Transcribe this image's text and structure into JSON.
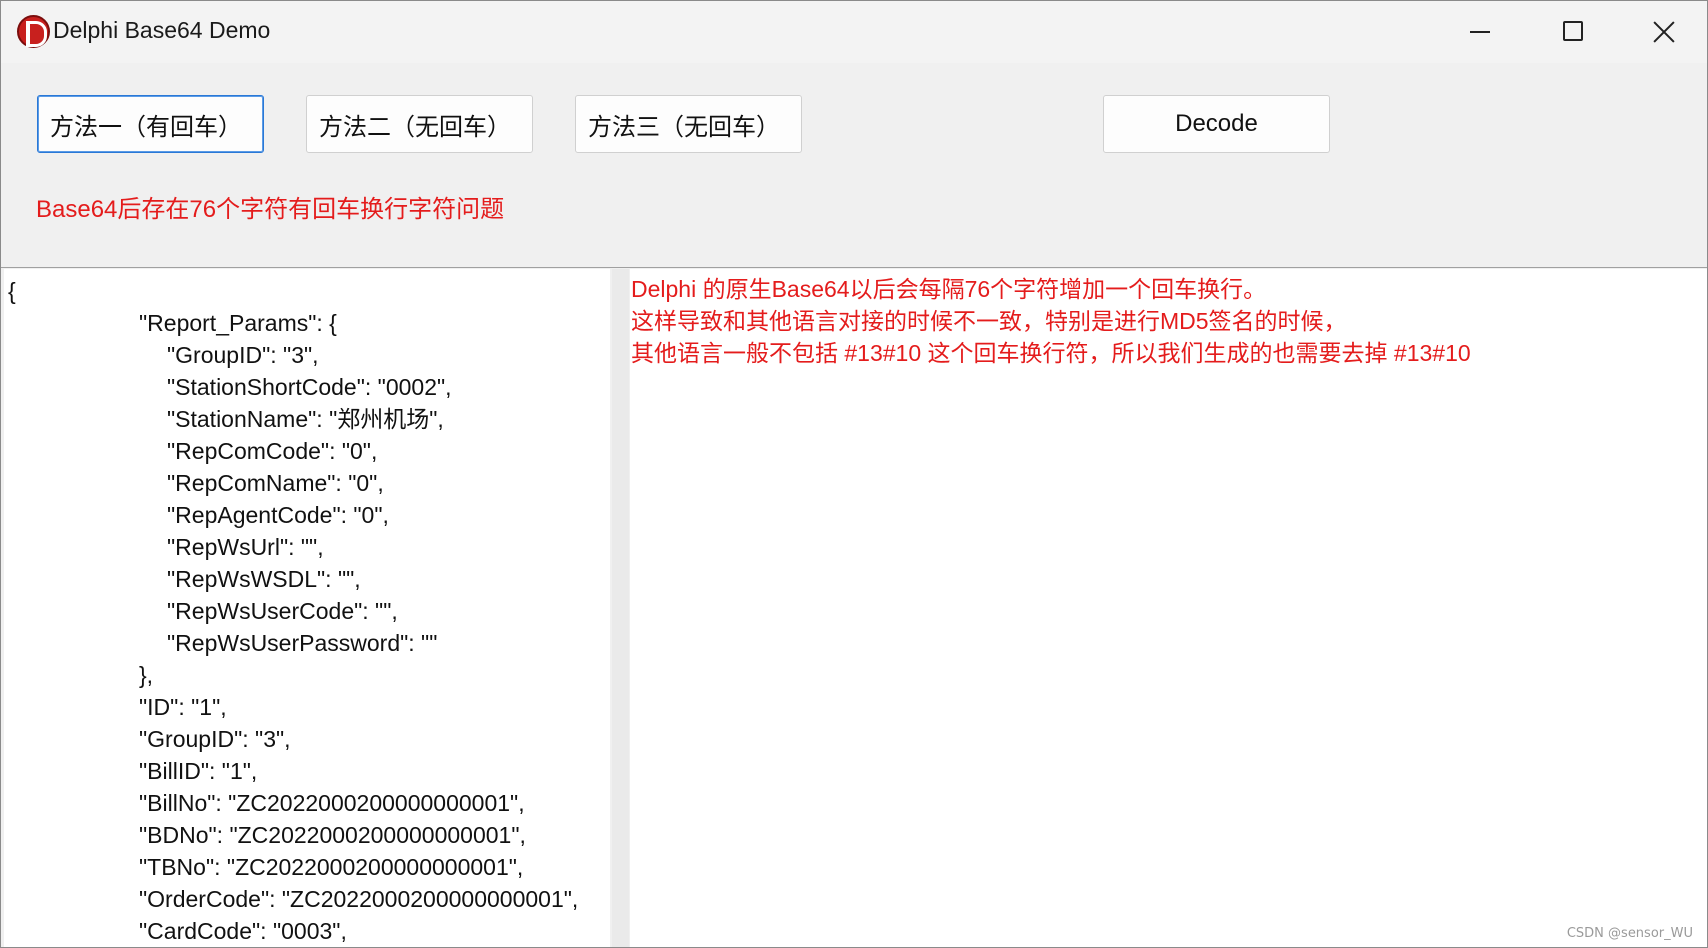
{
  "window": {
    "title": "Delphi Base64 Demo"
  },
  "icons": {
    "app": "delphi-logo-icon",
    "minimize": "minimize-icon",
    "maximize": "maximize-icon",
    "close": "close-icon"
  },
  "buttons": {
    "method1": "方法一（有回车）",
    "method2": "方法二（无回车）",
    "method3": "方法三（无回车）",
    "decode": "Decode"
  },
  "status_note": "Base64后存在76个字符有回车换行字符问题",
  "left_memo": {
    "lines": [
      "{",
      "\"Report_Params\": {",
      "\"GroupID\": \"3\",",
      "\"StationShortCode\": \"0002\",",
      "\"StationName\": \"郑州机场\",",
      "\"RepComCode\": \"0\",",
      "\"RepComName\": \"0\",",
      "\"RepAgentCode\": \"0\",",
      "\"RepWsUrl\": \"\",",
      "\"RepWsWSDL\": \"\",",
      "\"RepWsUserCode\": \"\",",
      "\"RepWsUserPassword\": \"\"",
      "},",
      "\"ID\": \"1\",",
      "\"GroupID\": \"3\",",
      "\"BillID\": \"1\",",
      "\"BillNo\": \"ZC2022000200000000001\",",
      "\"BDNo\": \"ZC2022000200000000001\",",
      "\"TBNo\": \"ZC2022000200000000001\",",
      "\"OrderCode\": \"ZC2022000200000000001\",",
      "\"CardCode\": \"0003\","
    ]
  },
  "right_memo": {
    "lines": [
      "Delphi 的原生Base64以后会每隔76个字符增加一个回车换行。",
      "这样导致和其他语言对接的时候不一致，特别是进行MD5签名的时候，",
      "其他语言一般不包括 #13#10 这个回车换行符，所以我们生成的也需要去掉 #13#10"
    ]
  },
  "watermark": "CSDN @sensor_WU",
  "colors": {
    "note_red": "#e41c1c",
    "focus_blue": "#2a78d6"
  }
}
